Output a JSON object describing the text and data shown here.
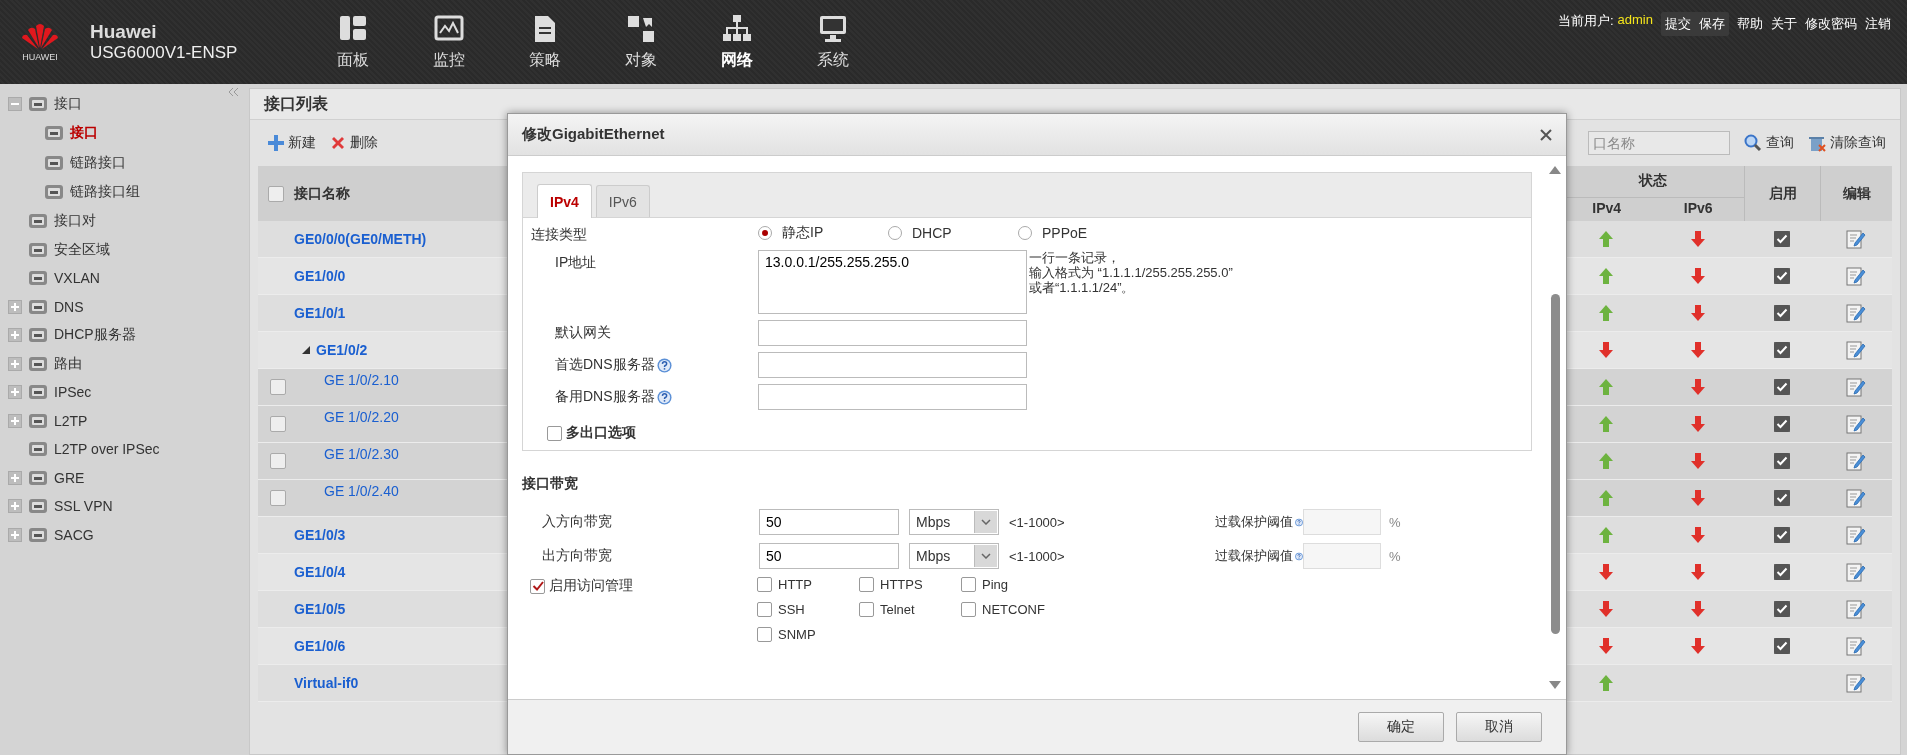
{
  "header": {
    "brand": "HUAWEI",
    "title": "Huawei",
    "model": "USG6000V1-ENSP",
    "nav": [
      {
        "label": "面板",
        "selected": false
      },
      {
        "label": "监控",
        "selected": false
      },
      {
        "label": "策略",
        "selected": false
      },
      {
        "label": "对象",
        "selected": false
      },
      {
        "label": "网络",
        "selected": true
      },
      {
        "label": "系统",
        "selected": false
      }
    ],
    "user_label": "当前用户:",
    "user": "admin",
    "actions": [
      "提交",
      "保存"
    ],
    "links": [
      "帮助",
      "关于",
      "修改密码",
      "注销"
    ]
  },
  "sidebar": {
    "items": [
      {
        "label": "接口",
        "expanded": true,
        "selected": false,
        "children": [
          {
            "label": "接口",
            "selected": true
          },
          {
            "label": "链路接口",
            "selected": false
          },
          {
            "label": "链路接口组",
            "selected": false
          }
        ]
      },
      {
        "label": "接口对",
        "selected": false
      },
      {
        "label": "安全区域",
        "selected": false
      },
      {
        "label": "VXLAN",
        "selected": false
      },
      {
        "label": "DNS",
        "expanded": false,
        "selected": false
      },
      {
        "label": "DHCP服务器",
        "expanded": false,
        "selected": false
      },
      {
        "label": "路由",
        "expanded": false,
        "selected": false
      },
      {
        "label": "IPSec",
        "expanded": false,
        "selected": false
      },
      {
        "label": "L2TP",
        "expanded": false,
        "selected": false
      },
      {
        "label": "L2TP over IPSec",
        "selected": false
      },
      {
        "label": "GRE",
        "expanded": false,
        "selected": false
      },
      {
        "label": "SSL VPN",
        "expanded": false,
        "selected": false
      },
      {
        "label": "SACG",
        "expanded": false,
        "selected": false
      }
    ]
  },
  "panel": {
    "title": "接口列表",
    "toolbar": [
      "新建",
      "删除"
    ],
    "search": {
      "placeholder": "口名称"
    },
    "query": "查询",
    "clear": "清除查询",
    "table": {
      "name_header": "接口名称",
      "status_header": "状态",
      "ipv4_header": "IPv4",
      "ipv6_header": "IPv6",
      "enabled_header": "启用",
      "edit_header": "编辑",
      "select_all_checked": false,
      "rows": [
        {
          "name": "GE0/0/0(GE0/METH)",
          "ipv4_up": true,
          "ipv6_up": false,
          "enabled": true
        },
        {
          "name": "GE1/0/0",
          "ipv4_up": true,
          "ipv6_up": false,
          "enabled": true
        },
        {
          "name": "GE1/0/1",
          "ipv4_up": true,
          "ipv6_up": false,
          "enabled": true
        },
        {
          "name": "GE1/0/2",
          "ipv4_up": false,
          "ipv6_up": false,
          "enabled": true,
          "expanded": true,
          "children": [
            {
              "name": "GE 1/0/2.10",
              "checked": false,
              "ipv4_up": true,
              "ipv6_up": false,
              "enabled": true
            },
            {
              "name": "GE 1/0/2.20",
              "checked": false,
              "ipv4_up": true,
              "ipv6_up": false,
              "enabled": true
            },
            {
              "name": "GE 1/0/2.30",
              "checked": false,
              "ipv4_up": true,
              "ipv6_up": false,
              "enabled": true
            },
            {
              "name": "GE 1/0/2.40",
              "checked": false,
              "ipv4_up": true,
              "ipv6_up": false,
              "enabled": true
            }
          ]
        },
        {
          "name": "GE1/0/3",
          "ipv4_up": true,
          "ipv6_up": false,
          "enabled": true
        },
        {
          "name": "GE1/0/4",
          "ipv4_up": false,
          "ipv6_up": false,
          "enabled": true
        },
        {
          "name": "GE1/0/5",
          "ipv4_up": false,
          "ipv6_up": false,
          "enabled": true
        },
        {
          "name": "GE1/0/6",
          "ipv4_up": false,
          "ipv6_up": false,
          "enabled": true
        },
        {
          "name": "Virtual-if0",
          "ipv4_up": true
        }
      ]
    }
  },
  "dialog": {
    "title": "修改GigabitEthernet",
    "tabs": [
      {
        "label": "IPv4",
        "selected": true
      },
      {
        "label": "IPv6",
        "selected": false
      }
    ],
    "connection_label": "连接类型",
    "connection_types": [
      {
        "label": "静态IP",
        "selected": true
      },
      {
        "label": "DHCP",
        "selected": false
      },
      {
        "label": "PPPoE",
        "selected": false
      }
    ],
    "ip_label": "IP地址",
    "ip_value": "13.0.0.1/255.255.255.0",
    "ip_hint": [
      "一行一条记录，",
      "输入格式为 “1.1.1.1/255.255.255.0”",
      "或者“1.1.1.1/24”。"
    ],
    "fields": [
      {
        "label": "默认网关",
        "help": false
      },
      {
        "label": "首选DNS服务器",
        "help": true
      },
      {
        "label": "备用DNS服务器",
        "help": true
      }
    ],
    "multi_exit": {
      "label": "多出口选项",
      "checked": false
    },
    "bandwidth_title": "接口带宽",
    "bandwidth": [
      {
        "label": "入方向带宽",
        "value": "50",
        "unit": "Mbps",
        "range": "<1-1000>",
        "overload_label": "过载保护阈值",
        "percent": "%"
      },
      {
        "label": "出方向带宽",
        "value": "50",
        "unit": "Mbps",
        "range": "<1-1000>",
        "overload_label": "过载保护阈值",
        "percent": "%"
      }
    ],
    "access": {
      "label": "启用访问管理",
      "checked": true,
      "protocols": [
        {
          "label": "HTTP",
          "checked": false
        },
        {
          "label": "HTTPS",
          "checked": false
        },
        {
          "label": "Ping",
          "checked": false
        },
        {
          "label": "SSH",
          "checked": false
        },
        {
          "label": "Telnet",
          "checked": false
        },
        {
          "label": "NETCONF",
          "checked": false
        },
        {
          "label": "SNMP",
          "checked": false
        }
      ]
    },
    "buttons": [
      "确定",
      "取消"
    ]
  }
}
